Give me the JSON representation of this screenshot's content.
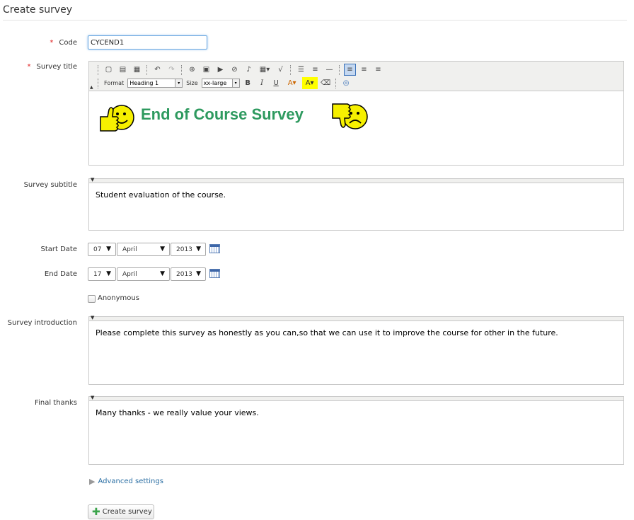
{
  "page": {
    "title": "Create survey"
  },
  "form": {
    "code": {
      "label": "Code",
      "value": "CYCEND1"
    },
    "title": {
      "label": "Survey title",
      "format_label": "Format",
      "format_value": "Heading 1",
      "size_label": "Size",
      "size_value": "xx-large",
      "content": "End of Course Survey",
      "heading_color": "#2e9a5f"
    },
    "subtitle": {
      "label": "Survey subtitle",
      "content": "Student evaluation of the course."
    },
    "start_date": {
      "label": "Start Date",
      "day": "07",
      "month": "April",
      "year": "2013"
    },
    "end_date": {
      "label": "End Date",
      "day": "17",
      "month": "April",
      "year": "2013"
    },
    "anonymous": {
      "label": "Anonymous",
      "checked": false
    },
    "intro": {
      "label": "Survey introduction",
      "content": "Please complete this survey as honestly as you can,so that we can use it to improve the course for other in the future."
    },
    "thanks": {
      "label": "Final thanks",
      "content": "Many thanks - we really value your views."
    },
    "advanced_label": "Advanced settings",
    "submit_label": "Create survey"
  },
  "icons": {
    "required": "asterisk-icon",
    "calendar": "calendar-icon",
    "thumbs_up": "thumbs-up-smiley-icon",
    "thumbs_down": "thumbs-down-smiley-icon"
  }
}
